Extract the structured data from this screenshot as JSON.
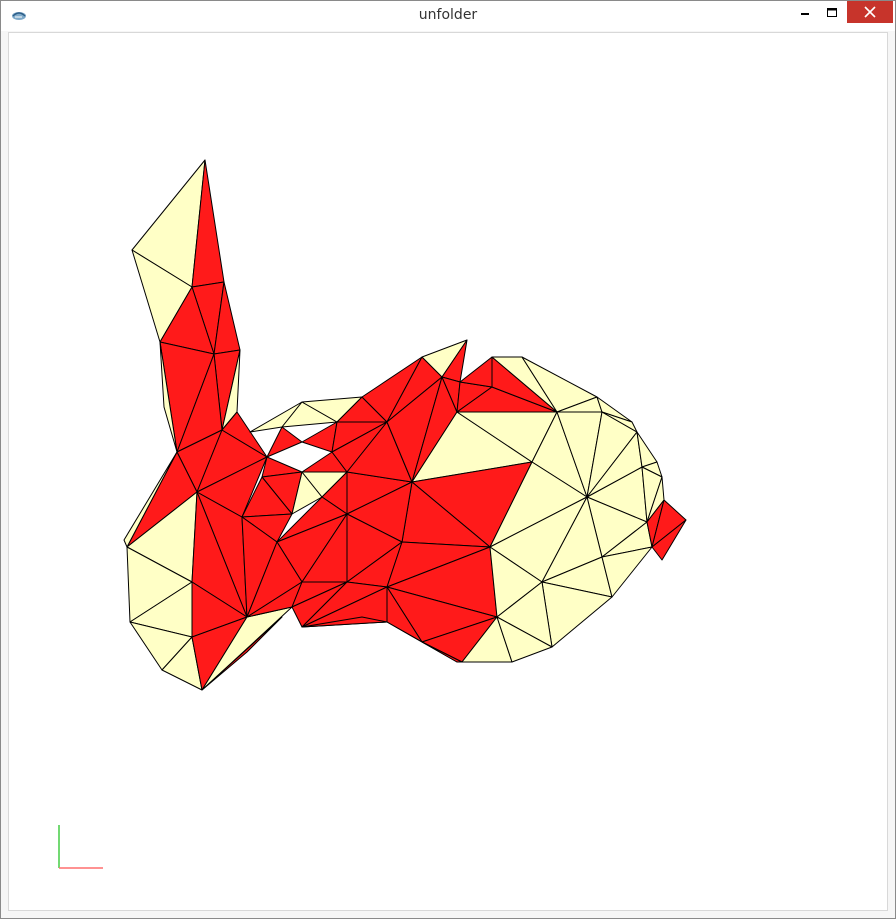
{
  "window": {
    "title": "unfolder"
  },
  "icons": {
    "app": "app-icon",
    "minimize": "minimize-icon",
    "maximize": "maximize-icon",
    "close": "close-icon"
  },
  "colors": {
    "face_light": "#ffffc6",
    "face_red": "#ff1a1a",
    "edge": "#000000",
    "close_button": "#c7342b",
    "axis_x": "#ff6f6f",
    "axis_y": "#44cc44"
  }
}
